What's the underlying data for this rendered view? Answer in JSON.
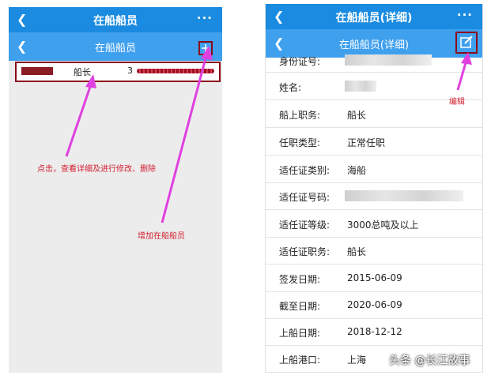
{
  "left_screen": {
    "header": {
      "title": "在船船员",
      "more_icon": "ellipsis-icon"
    },
    "subheader": {
      "title": "在船船员",
      "add_icon": "plus-icon"
    },
    "list": [
      {
        "name": "",
        "role": "船长",
        "id_prefix": "3"
      }
    ]
  },
  "right_screen": {
    "header": {
      "title": "在船船员(详细)",
      "more_icon": "ellipsis-icon"
    },
    "subheader": {
      "title": "在船船员(详细)",
      "edit_icon": "edit-icon"
    },
    "fields": [
      {
        "label": "身份证号:",
        "value": "",
        "redacted": true
      },
      {
        "label": "姓名:",
        "value": "",
        "redacted": true
      },
      {
        "label": "船上职务:",
        "value": "船长"
      },
      {
        "label": "任职类型:",
        "value": "正常任职"
      },
      {
        "label": "适任证类别:",
        "value": "海船"
      },
      {
        "label": "适任证号码:",
        "value": "",
        "redacted": true
      },
      {
        "label": "适任证等级:",
        "value": "3000总吨及以上"
      },
      {
        "label": "适任证职务:",
        "value": "船长"
      },
      {
        "label": "签发日期:",
        "value": "2015-06-09"
      },
      {
        "label": "截至日期:",
        "value": "2020-06-09"
      },
      {
        "label": "上船日期:",
        "value": "2018-12-12"
      },
      {
        "label": "上船港口:",
        "value": "上海"
      }
    ]
  },
  "annotations": {
    "click_hint": "点击，查看详细及进行修改、删除",
    "add_hint": "增加在船船员",
    "edit_hint": "编辑",
    "arrow_color": "#e040e0",
    "text_color": "#d21e2e"
  },
  "watermark": "头条 @长江故事",
  "colors": {
    "header": "#1a8be0",
    "subheader": "#3fa0ee",
    "highlight_border": "#8b0a1a"
  }
}
